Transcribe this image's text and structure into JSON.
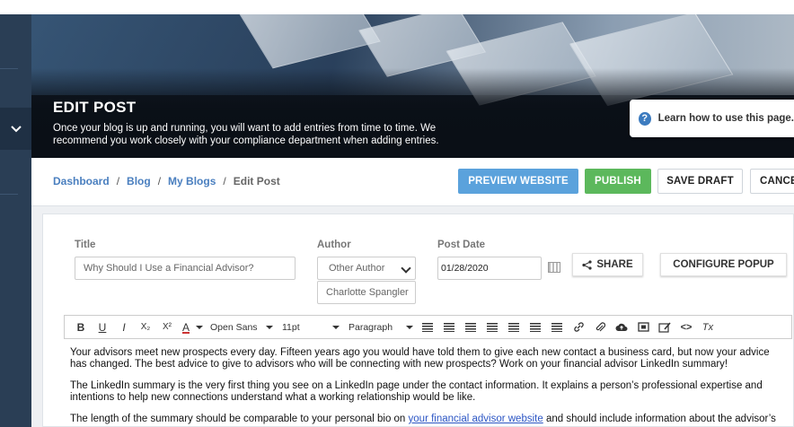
{
  "sidebar": {
    "toggle_icon": "chevron-down-icon"
  },
  "hero": {
    "title": "EDIT POST",
    "subtitle": "Once your blog is up and running, you will want to add entries from time to time. We recommend you work closely with your compliance department when adding entries.",
    "help_text": "Learn how to use this page.",
    "help_icon": "?"
  },
  "breadcrumb": {
    "items": [
      "Dashboard",
      "Blog",
      "My Blogs"
    ],
    "separator": "/",
    "current": "Edit Post"
  },
  "actions": {
    "preview": "PREVIEW WEBSITE",
    "publish": "PUBLISH",
    "save_draft": "SAVE DRAFT",
    "cancel": "CANCEL",
    "preview_color": "#5ba2dc",
    "publish_color": "#5cb85c"
  },
  "form": {
    "title_label": "Title",
    "title_value": "Why Should I Use a Financial Advisor?",
    "author_label": "Author",
    "author_select": "Other Author",
    "author_name": "Charlotte Spangler",
    "post_date_label": "Post Date",
    "post_date_value": "01/28/2020",
    "share_label": "SHARE",
    "configure_popup_label": "CONFIGURE POPUP"
  },
  "toolbar": {
    "bold": "B",
    "underline": "U",
    "italic": "I",
    "subscript": "X₂",
    "superscript": "X²",
    "font_color": "A",
    "font_family": "Open Sans",
    "font_size": "11pt",
    "block_format": "Paragraph",
    "code": "<>",
    "clear_format": "Tx"
  },
  "editor": {
    "p1": "Your advisors meet new prospects every day. Fifteen years ago you would have told them to give each new contact a business card, but now your advice has changed. The best advice to give to advisors who will be connecting with new prospects? Work on your financial advisor LinkedIn summary!",
    "p2": "The LinkedIn summary is the very first thing you see on a LinkedIn page under the contact information. It explains a person’s professional expertise and intentions to help new connections understand what a working relationship would be like.",
    "p3_before": "The length of the summary should be comparable to your personal bio on ",
    "p3_link": "your financial advisor website",
    "p3_after": " and should include information about the advisor’s"
  }
}
